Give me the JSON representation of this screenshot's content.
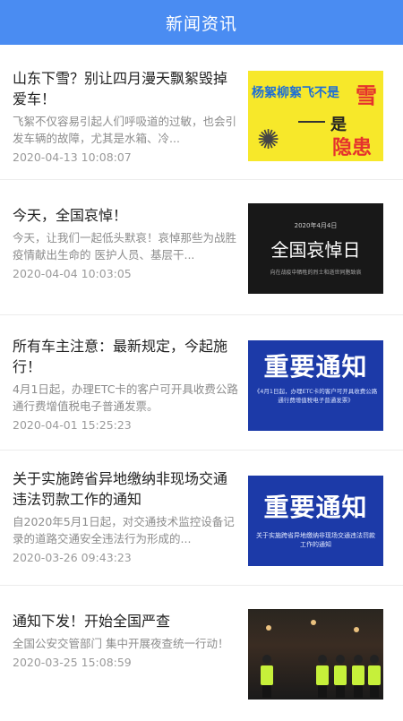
{
  "header": {
    "title": "新闻资讯"
  },
  "news": [
    {
      "title": "山东下雪？别让四月漫天飘絮毁掉爱车！",
      "summary": "飞絮不仅容易引起人们呼吸道的过敏，也会引发车辆的故障，尤其是水箱、冷...",
      "date": "2020-04-13 10:08:07",
      "thumb": {
        "line1": "杨絮柳絮飞不是",
        "big": "雪",
        "line2": "是",
        "line3": "隐患"
      }
    },
    {
      "title": "今天，全国哀悼！",
      "summary": "今天，让我们一起低头默哀！哀悼那些为战胜疫情献出生命的 医护人员、基层干...",
      "date": "2020-04-04 10:03:05",
      "thumb": {
        "date": "2020年4月4日",
        "main": "全国哀悼日",
        "sub": "向在战疫中牺牲的烈士和逝世同胞致哀"
      }
    },
    {
      "title": "所有车主注意：最新规定，今起施行！",
      "summary": "4月1日起，办理ETC卡的客户可开具收费公路通行费增值税电子普通发票。",
      "date": "2020-04-01 15:25:23",
      "thumb": {
        "main": "重要通知",
        "sub": "《4月1日起，办理ETC卡的客户可开具收费公路通行费增值税电子普通发票》"
      }
    },
    {
      "title": "关于实施跨省异地缴纳非现场交通违法罚款工作的通知",
      "summary": "自2020年5月1日起，对交通技术监控设备记录的道路交通安全违法行为形成的...",
      "date": "2020-03-26 09:43:23",
      "thumb": {
        "main": "重要通知",
        "sub": "关于实施跨省异地缴纳非现场交通违法罚款工作的通知"
      }
    },
    {
      "title": "通知下发！开始全国严查",
      "summary": "全国公安交管部门 集中开展夜查统一行动！",
      "date": "2020-03-25 15:08:59"
    }
  ]
}
